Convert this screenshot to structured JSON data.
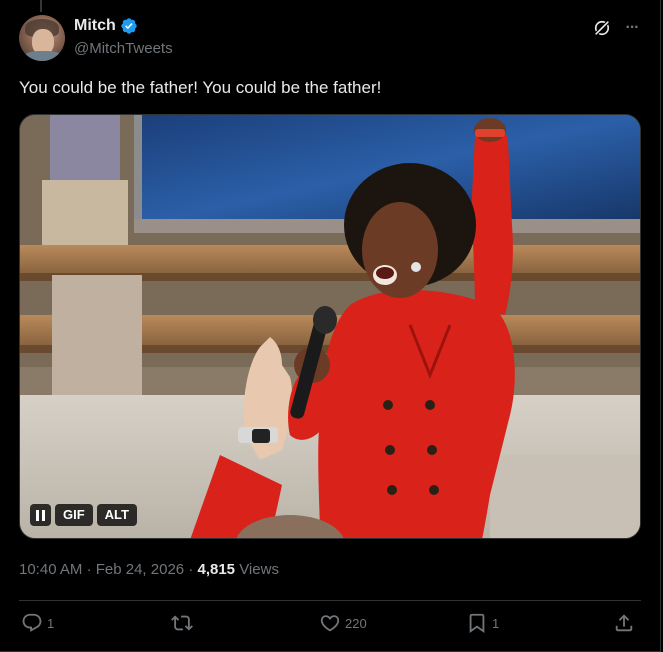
{
  "author": {
    "display_name": "Mitch",
    "handle": "@MitchTweets",
    "verified": true,
    "avatar": "avatar-photo"
  },
  "header_icons": {
    "grok": "grok-icon",
    "more": "more-horizontal-icon",
    "more_glyph": "···"
  },
  "tweet": {
    "text": "You could be the father! You could be the father!"
  },
  "media": {
    "type": "gif",
    "pause_icon": "pause-icon",
    "gif_label": "GIF",
    "alt_label": "ALT"
  },
  "meta": {
    "time": "10:40 AM",
    "sep1": "·",
    "date": "Feb 24, 2026",
    "sep2": "·",
    "views_count": "4,815",
    "views_label": "Views"
  },
  "actions": {
    "reply": {
      "icon": "reply-icon",
      "count": "1"
    },
    "retweet": {
      "icon": "retweet-icon",
      "count": ""
    },
    "like": {
      "icon": "heart-icon",
      "count": "220"
    },
    "bookmark": {
      "icon": "bookmark-icon",
      "count": "1"
    },
    "share": {
      "icon": "share-icon",
      "count": ""
    }
  },
  "colors": {
    "background": "#000000",
    "text_primary": "#e7e9ea",
    "text_secondary": "#71767b",
    "border": "#2f3336",
    "verified_blue": "#1d9bf0",
    "jacket_red": "#d9231a"
  }
}
